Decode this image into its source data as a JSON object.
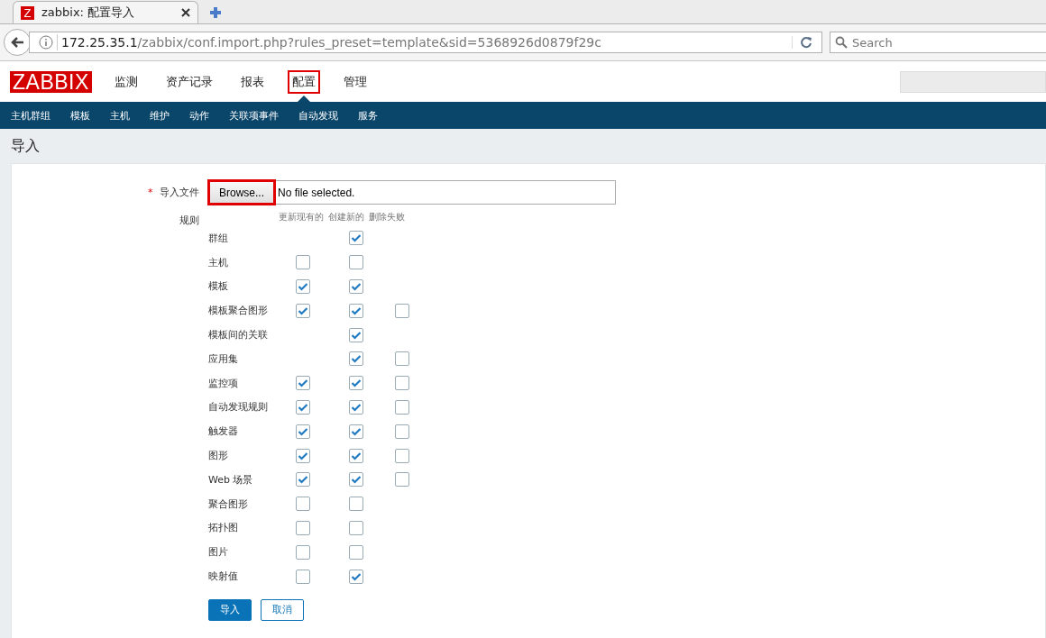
{
  "browser": {
    "tab": {
      "title": "zabbix: 配置导入",
      "icon_text": "Z"
    },
    "url": {
      "host": "172.25.35.1",
      "path": "/zabbix/conf.import.php?rules_preset=template&sid=5368926d0879f29c"
    },
    "search": {
      "placeholder": "Search"
    }
  },
  "header": {
    "logo": "ZABBIX",
    "menu": [
      {
        "label": "监测",
        "selected": false,
        "highlighted": false
      },
      {
        "label": "资产记录",
        "selected": false,
        "highlighted": false
      },
      {
        "label": "报表",
        "selected": false,
        "highlighted": false
      },
      {
        "label": "配置",
        "selected": true,
        "highlighted": true
      },
      {
        "label": "管理",
        "selected": false,
        "highlighted": false
      }
    ]
  },
  "submenu": [
    "主机群组",
    "模板",
    "主机",
    "维护",
    "动作",
    "关联项事件",
    "自动发现",
    "服务"
  ],
  "page_title": "导入",
  "form": {
    "file": {
      "label": "导入文件",
      "required": true,
      "required_mark": "*",
      "button": "Browse...",
      "button_highlighted": true,
      "value": "No file selected."
    },
    "rules_label": "规则",
    "columns": [
      "更新现有的",
      "创建新的",
      "删除失败"
    ],
    "rules": [
      {
        "name": "群组",
        "create": {
          "checked": true
        }
      },
      {
        "name": "主机",
        "update": {
          "checked": false
        },
        "create": {
          "checked": false
        }
      },
      {
        "name": "模板",
        "update": {
          "checked": true
        },
        "create": {
          "checked": true
        }
      },
      {
        "name": "模板聚合图形",
        "update": {
          "checked": true
        },
        "create": {
          "checked": true
        },
        "delete": {
          "checked": false
        }
      },
      {
        "name": "模板间的关联",
        "create": {
          "checked": true
        }
      },
      {
        "name": "应用集",
        "create": {
          "checked": true
        },
        "delete": {
          "checked": false
        }
      },
      {
        "name": "监控项",
        "update": {
          "checked": true
        },
        "create": {
          "checked": true
        },
        "delete": {
          "checked": false
        }
      },
      {
        "name": "自动发现规则",
        "update": {
          "checked": true
        },
        "create": {
          "checked": true
        },
        "delete": {
          "checked": false
        }
      },
      {
        "name": "触发器",
        "update": {
          "checked": true
        },
        "create": {
          "checked": true
        },
        "delete": {
          "checked": false
        }
      },
      {
        "name": "图形",
        "update": {
          "checked": true
        },
        "create": {
          "checked": true
        },
        "delete": {
          "checked": false
        }
      },
      {
        "name": "Web 场景",
        "update": {
          "checked": true
        },
        "create": {
          "checked": true
        },
        "delete": {
          "checked": false
        }
      },
      {
        "name": "聚合图形",
        "update": {
          "checked": false
        },
        "create": {
          "checked": false
        }
      },
      {
        "name": "拓扑图",
        "update": {
          "checked": false
        },
        "create": {
          "checked": false
        }
      },
      {
        "name": "图片",
        "update": {
          "checked": false
        },
        "create": {
          "checked": false
        }
      },
      {
        "name": "映射值",
        "update": {
          "checked": false
        },
        "create": {
          "checked": true
        }
      }
    ],
    "buttons": [
      {
        "label": "导入",
        "kind": "primary"
      },
      {
        "label": "取消",
        "kind": "secondary"
      }
    ]
  }
}
